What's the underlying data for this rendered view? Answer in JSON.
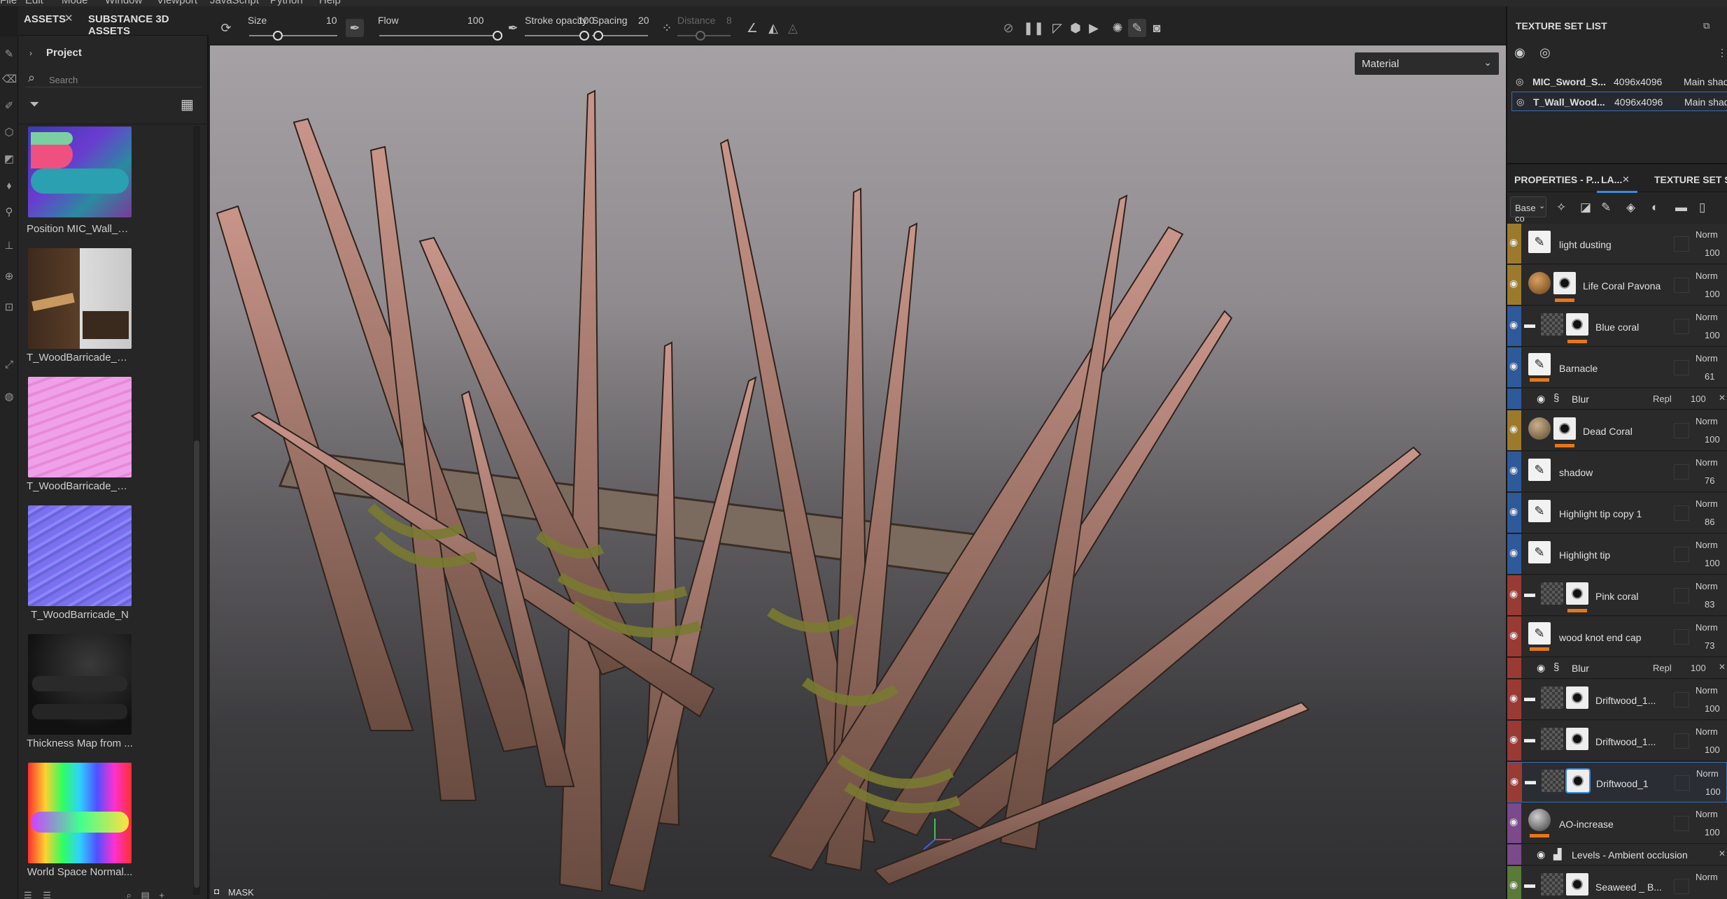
{
  "menubar": {
    "items": [
      "File",
      "Edit",
      "Mode",
      "Window",
      "Viewport",
      "JavaScript",
      "Python",
      "Help"
    ]
  },
  "assets_panel": {
    "tabs": [
      "ASSETS",
      "SUBSTANCE 3D ASSETS"
    ],
    "project_label": "Project",
    "search_placeholder": "Search",
    "items": [
      {
        "label": "Position MIC_Wall_W..."
      },
      {
        "label": "T_WoodBarricade_C..."
      },
      {
        "label": "T_WoodBarricade_La..."
      },
      {
        "label": "T_WoodBarricade_N"
      },
      {
        "label": "Thickness Map from ..."
      },
      {
        "label": "World Space Normal..."
      }
    ]
  },
  "toolbar": {
    "size": {
      "label": "Size",
      "value": "10"
    },
    "flow": {
      "label": "Flow",
      "value": "100"
    },
    "stroke_opacity": {
      "label": "Stroke opacity",
      "value": "100"
    },
    "spacing": {
      "label": "Spacing",
      "value": "20"
    },
    "distance": {
      "label": "Distance",
      "value": "8"
    }
  },
  "viewport": {
    "material_dropdown": "Material",
    "mask_label": "MASK"
  },
  "texture_set_list": {
    "title": "TEXTURE SET LIST",
    "rows": [
      {
        "name": "MIC_Sword_S...",
        "resolution": "4096x4096",
        "shader": "Main shade"
      },
      {
        "name": "T_Wall_Wood...",
        "resolution": "4096x4096",
        "shader": "Main shade"
      }
    ]
  },
  "layers_panel": {
    "tabs": [
      "PROPERTIES - P...",
      "LA...",
      "TEXTURE SET SET"
    ],
    "channel_select": "Base co",
    "layers": [
      {
        "name": "light dusting",
        "blend": "Norm",
        "opacity": "100",
        "color": "#9c7a2c",
        "kind": "paint"
      },
      {
        "name": "Life Coral Pavona",
        "blend": "Norm",
        "opacity": "100",
        "color": "#9c7a2c",
        "kind": "fill-mat"
      },
      {
        "name": "Blue coral",
        "blend": "Norm",
        "opacity": "100",
        "color": "#2e5a9a",
        "kind": "folder"
      },
      {
        "name": "Barnacle",
        "blend": "Norm",
        "opacity": "61",
        "color": "#2e5a9a",
        "kind": "paint"
      },
      {
        "name": "Blur",
        "blend": "Repl",
        "opacity": "100",
        "color": "#2e5a9a",
        "kind": "filter"
      },
      {
        "name": "Dead Coral",
        "blend": "Norm",
        "opacity": "100",
        "color": "#9c7a2c",
        "kind": "fill-mat2"
      },
      {
        "name": "shadow",
        "blend": "Norm",
        "opacity": "76",
        "color": "#2e5a9a",
        "kind": "paint"
      },
      {
        "name": "Highlight tip copy 1",
        "blend": "Norm",
        "opacity": "86",
        "color": "#2e5a9a",
        "kind": "paint"
      },
      {
        "name": "Highlight tip",
        "blend": "Norm",
        "opacity": "100",
        "color": "#2e5a9a",
        "kind": "paint"
      },
      {
        "name": "Pink coral",
        "blend": "Norm",
        "opacity": "83",
        "color": "#9a3a34",
        "kind": "folder"
      },
      {
        "name": "wood knot end cap",
        "blend": "Norm",
        "opacity": "73",
        "color": "#9a3a34",
        "kind": "paint"
      },
      {
        "name": "Blur",
        "blend": "Repl",
        "opacity": "100",
        "color": "#9a3a34",
        "kind": "filter"
      },
      {
        "name": "Driftwood_1...",
        "blend": "Norm",
        "opacity": "100",
        "color": "#9a3a34",
        "kind": "folder"
      },
      {
        "name": "Driftwood_1...",
        "blend": "Norm",
        "opacity": "100",
        "color": "#9a3a34",
        "kind": "folder"
      },
      {
        "name": "Driftwood_1",
        "blend": "Norm",
        "opacity": "100",
        "color": "#9a3a34",
        "kind": "folder"
      },
      {
        "name": "AO-increase",
        "blend": "Norm",
        "opacity": "100",
        "color": "#7a4a8a",
        "kind": "fill-sphere"
      },
      {
        "name": "Levels - Ambient occlusion",
        "blend": "",
        "opacity": "",
        "color": "#7a4a8a",
        "kind": "levels"
      },
      {
        "name": "Seaweed _ B...",
        "blend": "Norm",
        "opacity": "",
        "color": "#5a7a3a",
        "kind": "folder"
      }
    ]
  }
}
